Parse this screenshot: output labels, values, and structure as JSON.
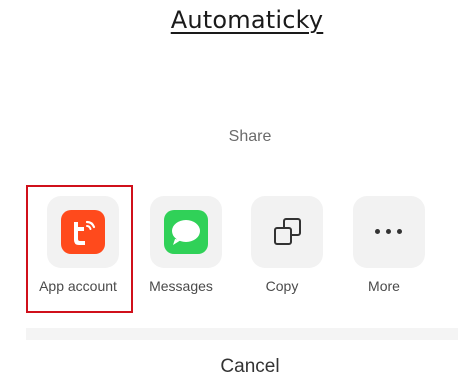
{
  "heading": "Automaticky",
  "share_sheet": {
    "title": "Share",
    "apps": [
      {
        "label": "App account",
        "icon": "tuya-app-icon",
        "color": "#ff4a1c"
      },
      {
        "label": "Messages",
        "icon": "messages-icon",
        "color": "#30d158"
      },
      {
        "label": "Copy",
        "icon": "copy-icon"
      },
      {
        "label": "More",
        "icon": "more-icon"
      }
    ],
    "cancel_label": "Cancel"
  },
  "highlight_color": "#d0101b"
}
